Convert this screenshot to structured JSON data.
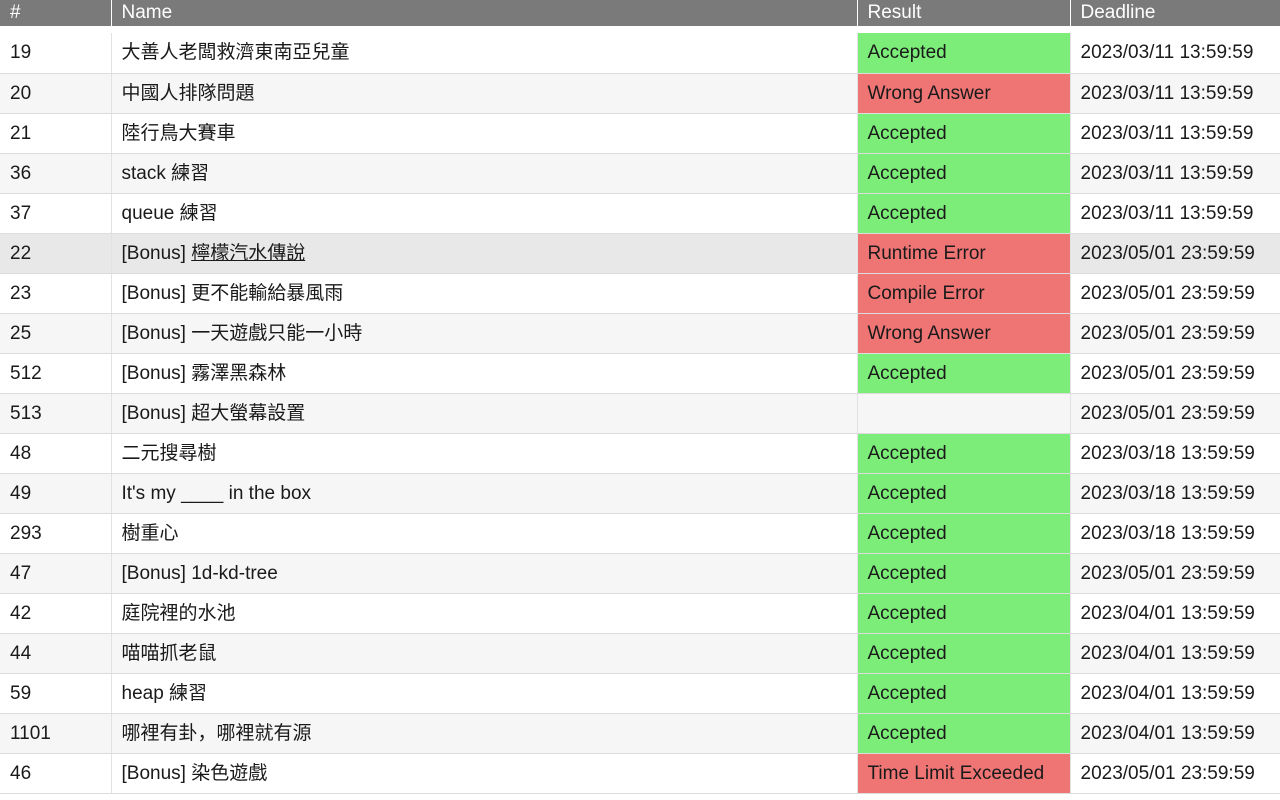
{
  "header": {
    "col_id": "#",
    "col_name": "Name",
    "col_result": "Result",
    "col_deadline": "Deadline"
  },
  "colors": {
    "header_bg": "#7a7a7a",
    "accepted": "#7ded7a",
    "error": "#ef7474"
  },
  "rows": [
    {
      "id": "19",
      "prefix": "",
      "name": "大善人老闆救濟東南亞兒童",
      "result": "Accepted",
      "status": "accepted",
      "deadline": "2023/03/11 13:59:59"
    },
    {
      "id": "20",
      "prefix": "",
      "name": "中國人排隊問題",
      "result": "Wrong Answer",
      "status": "error",
      "deadline": "2023/03/11 13:59:59"
    },
    {
      "id": "21",
      "prefix": "",
      "name": "陸行鳥大賽車",
      "result": "Accepted",
      "status": "accepted",
      "deadline": "2023/03/11 13:59:59"
    },
    {
      "id": "36",
      "prefix": "",
      "name": "stack 練習",
      "result": "Accepted",
      "status": "accepted",
      "deadline": "2023/03/11 13:59:59"
    },
    {
      "id": "37",
      "prefix": "",
      "name": "queue 練習",
      "result": "Accepted",
      "status": "accepted",
      "deadline": "2023/03/11 13:59:59"
    },
    {
      "id": "22",
      "prefix": "[Bonus] ",
      "name": "檸檬汽水傳說",
      "result": "Runtime Error",
      "status": "error",
      "deadline": "2023/05/01 23:59:59",
      "hover": true
    },
    {
      "id": "23",
      "prefix": "",
      "name": "[Bonus] 更不能輸給暴風雨",
      "result": "Compile Error",
      "status": "error",
      "deadline": "2023/05/01 23:59:59"
    },
    {
      "id": "25",
      "prefix": "",
      "name": "[Bonus] 一天遊戲只能一小時",
      "result": "Wrong Answer",
      "status": "error",
      "deadline": "2023/05/01 23:59:59"
    },
    {
      "id": "512",
      "prefix": "",
      "name": "[Bonus] 霧澤黑森林",
      "result": "Accepted",
      "status": "accepted",
      "deadline": "2023/05/01 23:59:59"
    },
    {
      "id": "513",
      "prefix": "",
      "name": "[Bonus] 超大螢幕設置",
      "result": "",
      "status": "empty",
      "deadline": "2023/05/01 23:59:59"
    },
    {
      "id": "48",
      "prefix": "",
      "name": "二元搜尋樹",
      "result": "Accepted",
      "status": "accepted",
      "deadline": "2023/03/18 13:59:59"
    },
    {
      "id": "49",
      "prefix": "",
      "name": "It's my ____ in the box",
      "result": "Accepted",
      "status": "accepted",
      "deadline": "2023/03/18 13:59:59"
    },
    {
      "id": "293",
      "prefix": "",
      "name": "樹重心",
      "result": "Accepted",
      "status": "accepted",
      "deadline": "2023/03/18 13:59:59"
    },
    {
      "id": "47",
      "prefix": "",
      "name": "[Bonus] 1d-kd-tree",
      "result": "Accepted",
      "status": "accepted",
      "deadline": "2023/05/01 23:59:59"
    },
    {
      "id": "42",
      "prefix": "",
      "name": "庭院裡的水池",
      "result": "Accepted",
      "status": "accepted",
      "deadline": "2023/04/01 13:59:59"
    },
    {
      "id": "44",
      "prefix": "",
      "name": "喵喵抓老鼠",
      "result": "Accepted",
      "status": "accepted",
      "deadline": "2023/04/01 13:59:59"
    },
    {
      "id": "59",
      "prefix": "",
      "name": "heap 練習",
      "result": "Accepted",
      "status": "accepted",
      "deadline": "2023/04/01 13:59:59"
    },
    {
      "id": "1101",
      "prefix": "",
      "name": "哪裡有卦，哪裡就有源",
      "result": "Accepted",
      "status": "accepted",
      "deadline": "2023/04/01 13:59:59"
    },
    {
      "id": "46",
      "prefix": "",
      "name": "[Bonus] 染色遊戲",
      "result": "Time Limit Exceeded",
      "status": "error",
      "deadline": "2023/05/01 23:59:59"
    }
  ]
}
